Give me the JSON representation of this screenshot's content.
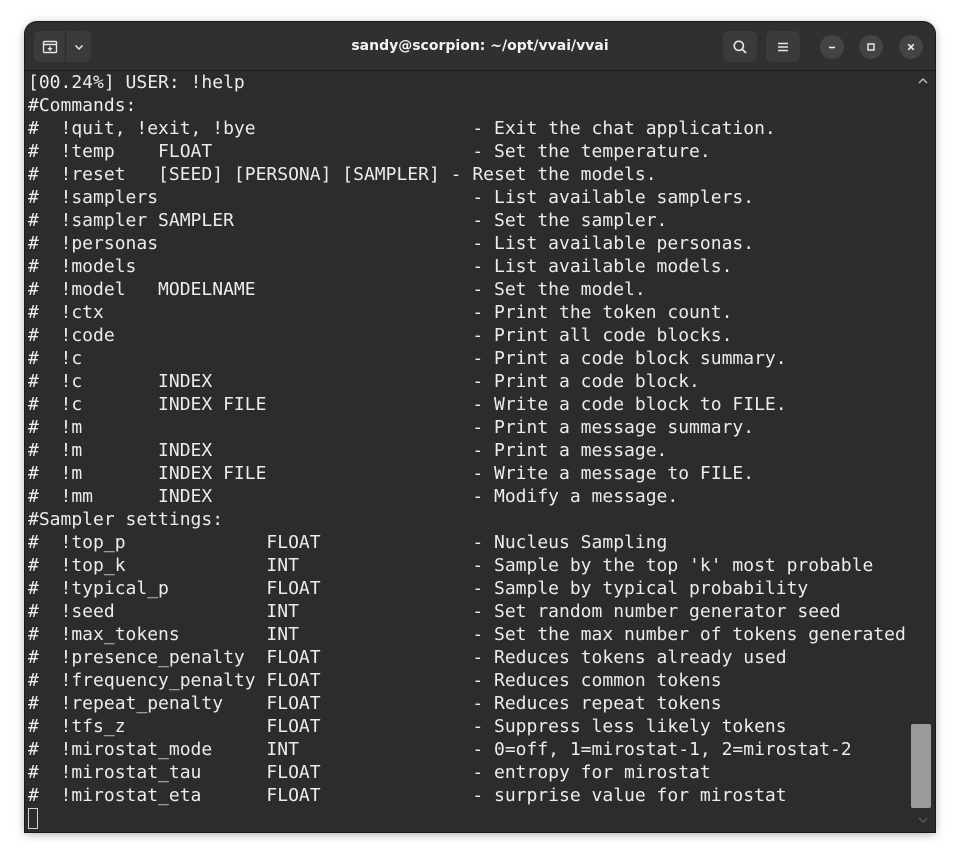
{
  "window": {
    "title": "sandy@scorpion: ~/opt/vvai/vvai"
  },
  "icons": {
    "new_tab": "new-tab-icon",
    "tab_menu": "chevron-down-icon",
    "search": "search-icon",
    "menu": "hamburger-menu-icon",
    "minimize": "minimize-icon",
    "maximize": "maximize-icon",
    "close": "close-icon",
    "scroll_up": "chevron-up-icon",
    "scroll_down": "chevron-down-icon"
  },
  "colors": {
    "background": "#2c2c2c",
    "titlebar": "#303030",
    "text": "#ececec",
    "scroll_thumb": "#9a9a9a"
  },
  "terminal": {
    "lines": [
      "[00.24%] USER: !help",
      "#Commands:",
      "#  !quit, !exit, !bye                    - Exit the chat application.",
      "#  !temp    FLOAT                        - Set the temperature.",
      "#  !reset   [SEED] [PERSONA] [SAMPLER] - Reset the models.",
      "#  !samplers                             - List available samplers.",
      "#  !sampler SAMPLER                      - Set the sampler.",
      "#  !personas                             - List available personas.",
      "#  !models                               - List available models.",
      "#  !model   MODELNAME                    - Set the model.",
      "#  !ctx                                  - Print the token count.",
      "#  !code                                 - Print all code blocks.",
      "#  !c                                    - Print a code block summary.",
      "#  !c       INDEX                        - Print a code block.",
      "#  !c       INDEX FILE                   - Write a code block to FILE.",
      "#  !m                                    - Print a message summary.",
      "#  !m       INDEX                        - Print a message.",
      "#  !m       INDEX FILE                   - Write a message to FILE.",
      "#  !mm      INDEX                        - Modify a message.",
      "#Sampler settings:",
      "#  !top_p             FLOAT              - Nucleus Sampling",
      "#  !top_k             INT                - Sample by the top 'k' most probable",
      "#  !typical_p         FLOAT              - Sample by typical probability",
      "#  !seed              INT                - Set random number generator seed",
      "#  !max_tokens        INT                - Set the max number of tokens generated",
      "#  !presence_penalty  FLOAT              - Reduces tokens already used",
      "#  !frequency_penalty FLOAT              - Reduces common tokens",
      "#  !repeat_penalty    FLOAT              - Reduces repeat tokens",
      "#  !tfs_z             FLOAT              - Suppress less likely tokens",
      "#  !mirostat_mode     INT                - 0=off, 1=mirostat-1, 2=mirostat-2",
      "#  !mirostat_tau      FLOAT              - entropy for mirostat",
      "#  !mirostat_eta      FLOAT              - surprise value for mirostat"
    ]
  }
}
